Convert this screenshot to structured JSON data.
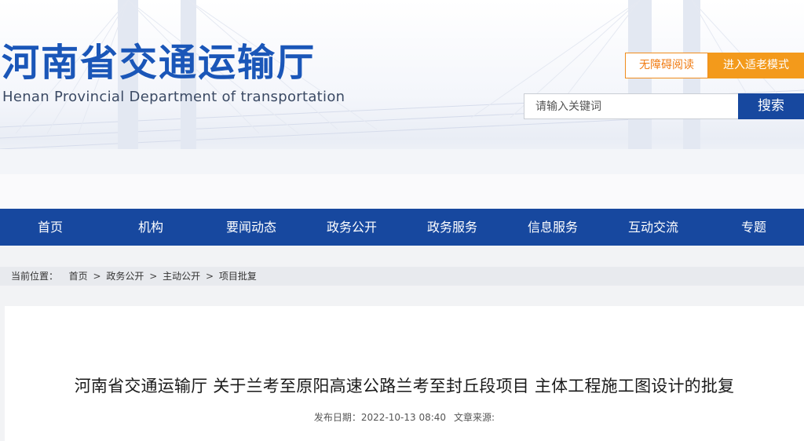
{
  "header": {
    "title_cn": "河南省交通运输厅",
    "title_en": "Henan Provincial Department of transportation",
    "accessibility_label": "无障碍阅读",
    "elder_mode_label": "进入适老模式",
    "search_placeholder": "请输入关键词",
    "search_button_label": "搜索"
  },
  "nav": {
    "items": [
      {
        "label": "首页"
      },
      {
        "label": "机构"
      },
      {
        "label": "要闻动态"
      },
      {
        "label": "政务公开"
      },
      {
        "label": "政务服务"
      },
      {
        "label": "信息服务"
      },
      {
        "label": "互动交流"
      },
      {
        "label": "专题"
      }
    ]
  },
  "breadcrumb": {
    "prefix": "当前位置：",
    "items": [
      {
        "label": "首页"
      },
      {
        "label": "政务公开"
      },
      {
        "label": "主动公开"
      },
      {
        "label": "项目批复"
      }
    ],
    "separator": ">"
  },
  "article": {
    "title": "河南省交通运输厅 关于兰考至原阳高速公路兰考至封丘段项目 主体工程施工图设计的批复",
    "publish_label": "发布日期：",
    "publish_date": "2022-10-13 08:40",
    "source_label": "文章来源:"
  },
  "colors": {
    "brand_blue": "#17489f",
    "accent_orange": "#f39a1b"
  }
}
